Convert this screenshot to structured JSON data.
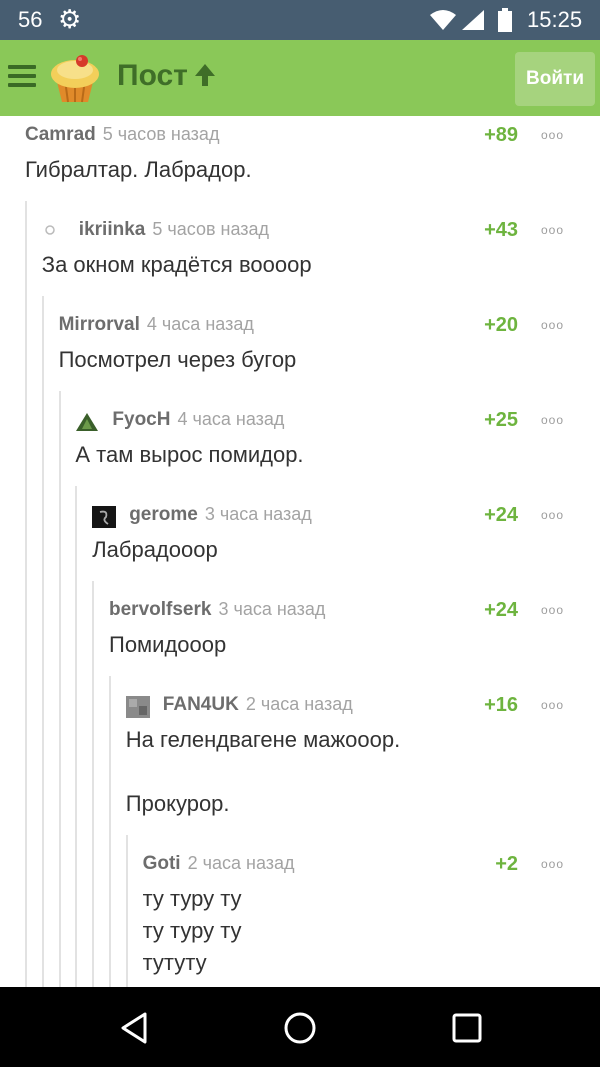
{
  "status_bar": {
    "notification_count": "56",
    "time": "15:25"
  },
  "header": {
    "title": "Пост",
    "login_label": "Войти",
    "brand_color": "#8ac858"
  },
  "comments": [
    {
      "author": "Camrad",
      "time": "5 часов назад",
      "rating": "+89",
      "text": "Гибралтар. Лабрадор.",
      "level": 0,
      "avatar": "none"
    },
    {
      "author": "ikriinka",
      "time": "5 часов назад",
      "rating": "+43",
      "text": "За окном крадётся воооор",
      "level": 1,
      "avatar": "small-gray"
    },
    {
      "author": "Mirrorval",
      "time": "4 часа назад",
      "rating": "+20",
      "text": "Посмотрел через бугор",
      "level": 2,
      "avatar": "none"
    },
    {
      "author": "FyocH",
      "time": "4 часа назад",
      "rating": "+25",
      "text": "А там вырос помидор.",
      "level": 3,
      "avatar": "green-triangle"
    },
    {
      "author": "gerome",
      "time": "3 часа назад",
      "rating": "+24",
      "text": "Лабрадооор",
      "level": 4,
      "avatar": "dark"
    },
    {
      "author": "bervolfserk",
      "time": "3 часа назад",
      "rating": "+24",
      "text": "Помидооор",
      "level": 5,
      "avatar": "none"
    },
    {
      "author": "FAN4UK",
      "time": "2 часа назад",
      "rating": "+16",
      "text": "На гелендвагене мажооор.\n\nПрокурор.",
      "level": 6,
      "avatar": "gray-photo"
    },
    {
      "author": "Goti",
      "time": "2 часа назад",
      "rating": "+2",
      "text": "ту туру ту\nту туру ту\nтутуту",
      "level": 7,
      "avatar": "none"
    }
  ],
  "more_glyph": "ooo"
}
